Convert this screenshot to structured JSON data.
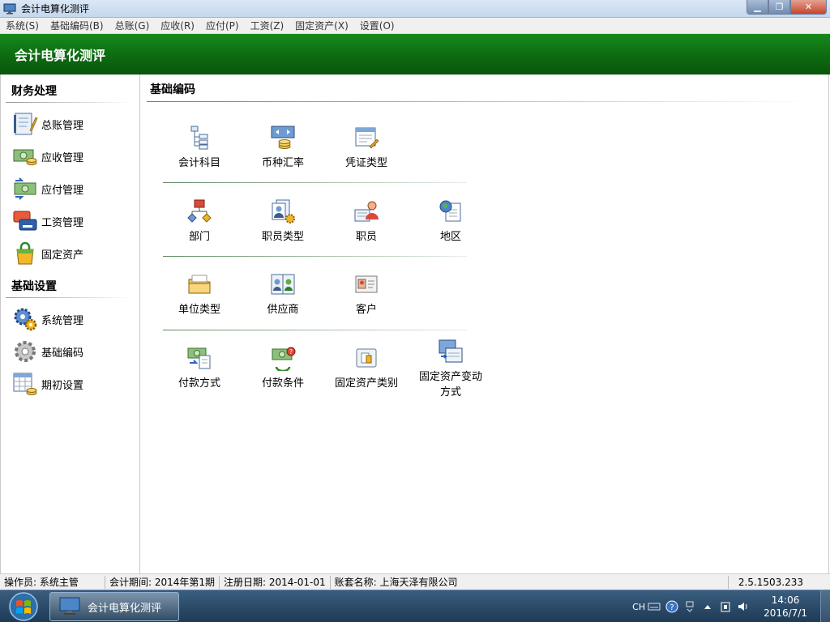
{
  "window": {
    "title": "会计电算化测评",
    "minimize": "▁",
    "maximize": "❐",
    "close": "✕"
  },
  "menu": [
    "系统(S)",
    "基础编码(B)",
    "总账(G)",
    "应收(R)",
    "应付(P)",
    "工资(Z)",
    "固定资产(X)",
    "设置(O)"
  ],
  "banner": {
    "title": "会计电算化测评"
  },
  "sidebar": {
    "sections": [
      {
        "title": "财务处理",
        "items": [
          "总账管理",
          "应收管理",
          "应付管理",
          "工资管理",
          "固定资产"
        ]
      },
      {
        "title": "基础设置",
        "items": [
          "系统管理",
          "基础编码",
          "期初设置"
        ]
      }
    ]
  },
  "main": {
    "title": "基础编码",
    "rows": [
      [
        "会计科目",
        "币种汇率",
        "凭证类型"
      ],
      [
        "部门",
        "职员类型",
        "职员",
        "地区"
      ],
      [
        "单位类型",
        "供应商",
        "客户"
      ],
      [
        "付款方式",
        "付款条件",
        "固定资产类别",
        "固定资产变动方式"
      ]
    ],
    "wrapped_label": {
      "line1": "固定资产变动",
      "line2": "方式"
    }
  },
  "status": {
    "operator": "操作员: 系统主管",
    "period": "会计期间: 2014年第1期",
    "register_date": "注册日期: 2014-01-01",
    "company": "账套名称: 上海天泽有限公司",
    "version": "2.5.1503.233"
  },
  "taskbar": {
    "task_label": "会计电算化测评",
    "lang": "CH",
    "time": "14:06",
    "date": "2016/7/1"
  },
  "icons": {
    "app": "monitor-icon",
    "tiles": [
      "tree-list-icon",
      "currency-exchange-icon",
      "voucher-form-icon",
      "department-icon",
      "staff-type-icon",
      "staff-icon",
      "globe-region-icon",
      "folder-unit-icon",
      "address-book-icon",
      "customer-card-icon",
      "payment-method-icon",
      "payment-terms-icon",
      "asset-category-icon",
      "asset-change-icon"
    ]
  }
}
